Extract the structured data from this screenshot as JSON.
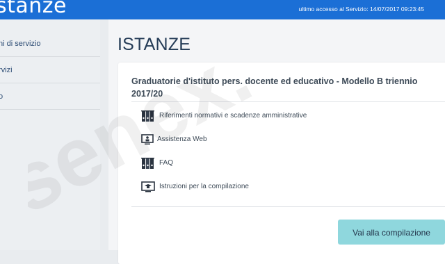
{
  "header": {
    "brand": "stanze",
    "last_access": "ultimo accesso al Servizio: 14/07/2017 09:23:45"
  },
  "sidebar": {
    "items": [
      {
        "label": "ni di servizio"
      },
      {
        "label": "rvizi"
      },
      {
        "label": "o"
      }
    ]
  },
  "main": {
    "title": "ISTANZE",
    "card": {
      "title": "Graduatorie d'istituto pers. docente ed educativo - Modello B triennio 2017/20",
      "links": [
        {
          "label": "Riferimenti normativi e scadenze amministrative",
          "icon": "binders-icon"
        },
        {
          "label": "Assistenza Web",
          "icon": "monitor-user-icon"
        },
        {
          "label": "FAQ",
          "icon": "binders-icon"
        },
        {
          "label": "Istruzioni per la compilazione",
          "icon": "monitor-cap-icon"
        }
      ],
      "cta": "Vai alla compilazione"
    }
  },
  "watermark": {
    "text": "senex."
  },
  "colors": {
    "header_bg": "#1b6fd6",
    "button_bg": "#8fd7dd",
    "title_text": "#253c57"
  }
}
